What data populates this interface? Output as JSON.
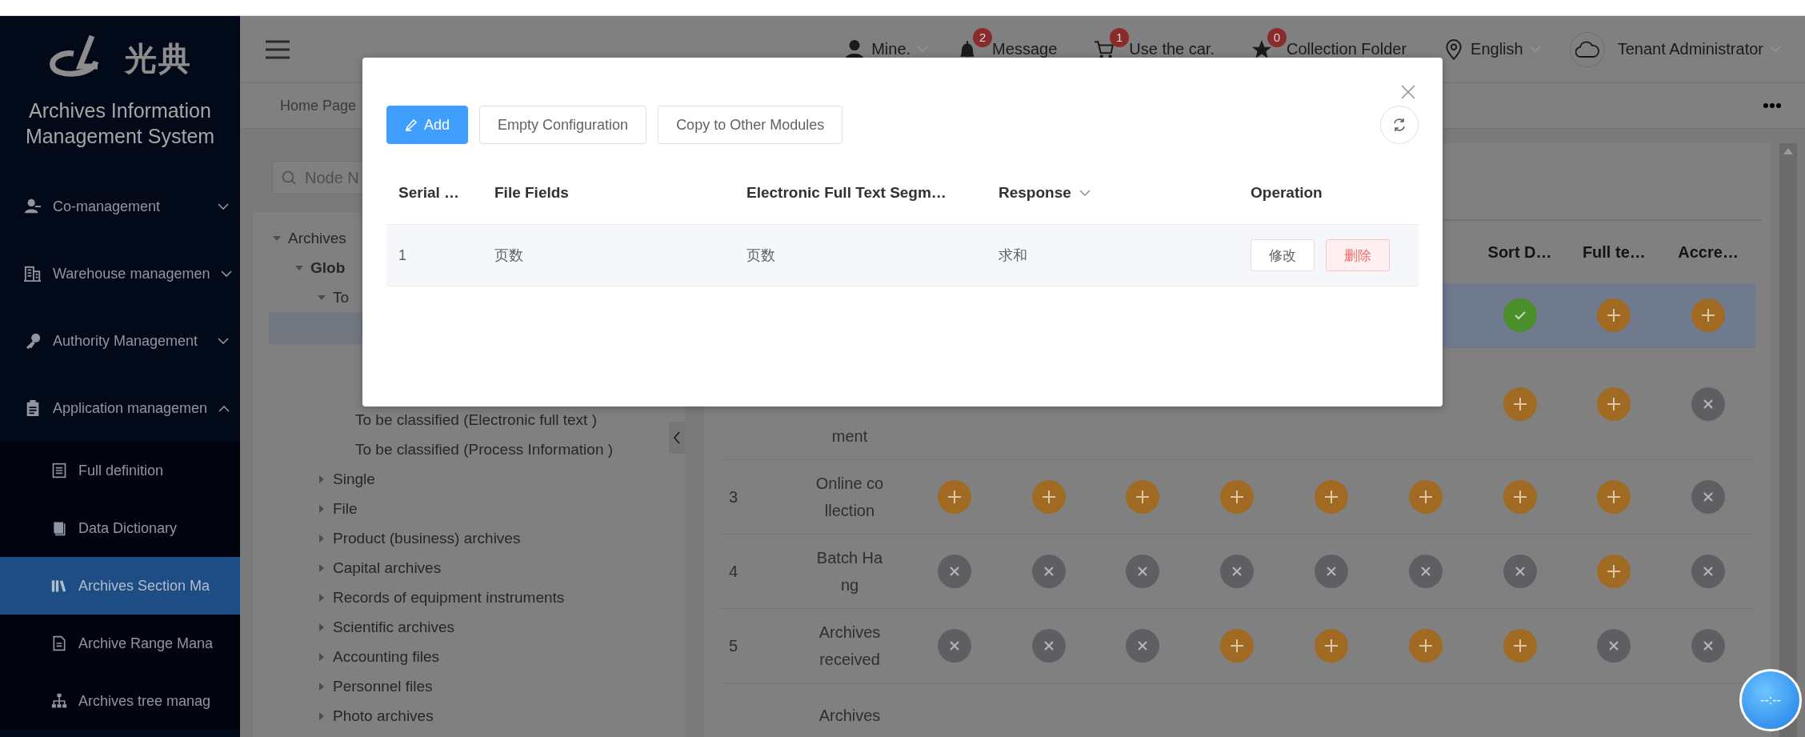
{
  "top_bar": {
    "user": "Mine.",
    "notifications": [
      {
        "label": "Message",
        "count": "2"
      },
      {
        "label": "Use the car.",
        "count": "1"
      },
      {
        "label": "Collection Folder",
        "count": "0"
      }
    ],
    "language": "English",
    "account": "Tenant Administrator"
  },
  "sidebar": {
    "logo_text": "光典",
    "title": "Archives Information Management System",
    "menu": [
      {
        "label": "Co-management",
        "expanded": false
      },
      {
        "label": "Warehouse managemen",
        "expanded": false
      },
      {
        "label": "Authority Management",
        "expanded": false
      },
      {
        "label": "Application managemen",
        "expanded": true,
        "children": [
          {
            "label": "Full definition",
            "selected": false
          },
          {
            "label": "Data Dictionary",
            "selected": false
          },
          {
            "label": "Archives Section Ma",
            "selected": true
          },
          {
            "label": "Archive Range Mana",
            "selected": false
          },
          {
            "label": "Archives tree manag",
            "selected": false
          }
        ]
      }
    ]
  },
  "breadcrumb": "Home Page",
  "tree_panel": {
    "search": {
      "placeholder": "Node N"
    },
    "tree": [
      {
        "label": "Archives",
        "expanded": true,
        "children": [
          {
            "label": "Glob",
            "expanded": true,
            "children": [
              {
                "label": "To",
                "expanded": true,
                "children": [
                  {
                    "label": "To be classified (Electronic full text )"
                  },
                  {
                    "label": "To be classified (Process Information )"
                  }
                ]
              },
              {
                "label": "Single",
                "expanded": false
              },
              {
                "label": "File",
                "expanded": false
              },
              {
                "label": "Product (business) archives",
                "expanded": false
              },
              {
                "label": "Capital archives",
                "expanded": false
              },
              {
                "label": "Records of equipment instruments",
                "expanded": false
              },
              {
                "label": "Scientific archives",
                "expanded": false
              },
              {
                "label": "Accounting files",
                "expanded": false
              },
              {
                "label": "Personnel files",
                "expanded": false
              },
              {
                "label": "Photo archives",
                "expanded": false
              }
            ]
          }
        ]
      }
    ]
  },
  "records_table": {
    "columns": [
      "Sort D…",
      "Full te…",
      "Accre…"
    ],
    "rows": [
      {
        "selected": true,
        "cells": [
          {
            "kind": "check"
          },
          {
            "kind": "add"
          },
          {
            "kind": "add"
          }
        ]
      },
      {
        "selected": false,
        "name": "ment",
        "cells": [
          {
            "kind": "add"
          },
          {
            "kind": "add"
          },
          {
            "kind": "close"
          }
        ]
      },
      {
        "selected": false,
        "number": "3",
        "name": "Online collection",
        "cells": [
          {
            "kind": "add"
          },
          {
            "kind": "add"
          },
          {
            "kind": "add"
          },
          {
            "kind": "add"
          },
          {
            "kind": "add"
          },
          {
            "kind": "add"
          },
          {
            "kind": "add"
          },
          {
            "kind": "add"
          },
          {
            "kind": "close"
          }
        ]
      },
      {
        "selected": false,
        "number": "4",
        "name": "Batch Hang",
        "cells": [
          {
            "kind": "close"
          },
          {
            "kind": "close"
          },
          {
            "kind": "close"
          },
          {
            "kind": "close"
          },
          {
            "kind": "close"
          },
          {
            "kind": "close"
          },
          {
            "kind": "close"
          },
          {
            "kind": "add"
          },
          {
            "kind": "close"
          }
        ]
      },
      {
        "selected": false,
        "number": "5",
        "name": "Archives received",
        "cells": [
          {
            "kind": "close"
          },
          {
            "kind": "close"
          },
          {
            "kind": "close"
          },
          {
            "kind": "add"
          },
          {
            "kind": "add"
          },
          {
            "kind": "add"
          },
          {
            "kind": "add"
          },
          {
            "kind": "close"
          },
          {
            "kind": "close"
          }
        ]
      },
      {
        "selected": false,
        "name": "Archives",
        "cells": []
      }
    ]
  },
  "dialog": {
    "buttons": [
      {
        "label": "Add",
        "kind": "primary"
      },
      {
        "label": "Empty Configuration",
        "kind": "default"
      },
      {
        "label": "Copy to Other Modules",
        "kind": "default"
      }
    ],
    "table": {
      "columns": [
        {
          "label": "Serial …",
          "sortable": false
        },
        {
          "label": "File Fields",
          "sortable": false
        },
        {
          "label": "Electronic Full Text Segm…",
          "sortable": false
        },
        {
          "label": "Response",
          "sortable": true
        },
        {
          "label": "Operation",
          "sortable": false
        }
      ],
      "rows": [
        {
          "cells": [
            "1",
            "页数",
            "页数",
            "求和"
          ],
          "actions": [
            {
              "label": "修改",
              "kind": "default"
            },
            {
              "label": "删除",
              "kind": "danger"
            }
          ]
        }
      ]
    }
  },
  "clock": "--:--"
}
